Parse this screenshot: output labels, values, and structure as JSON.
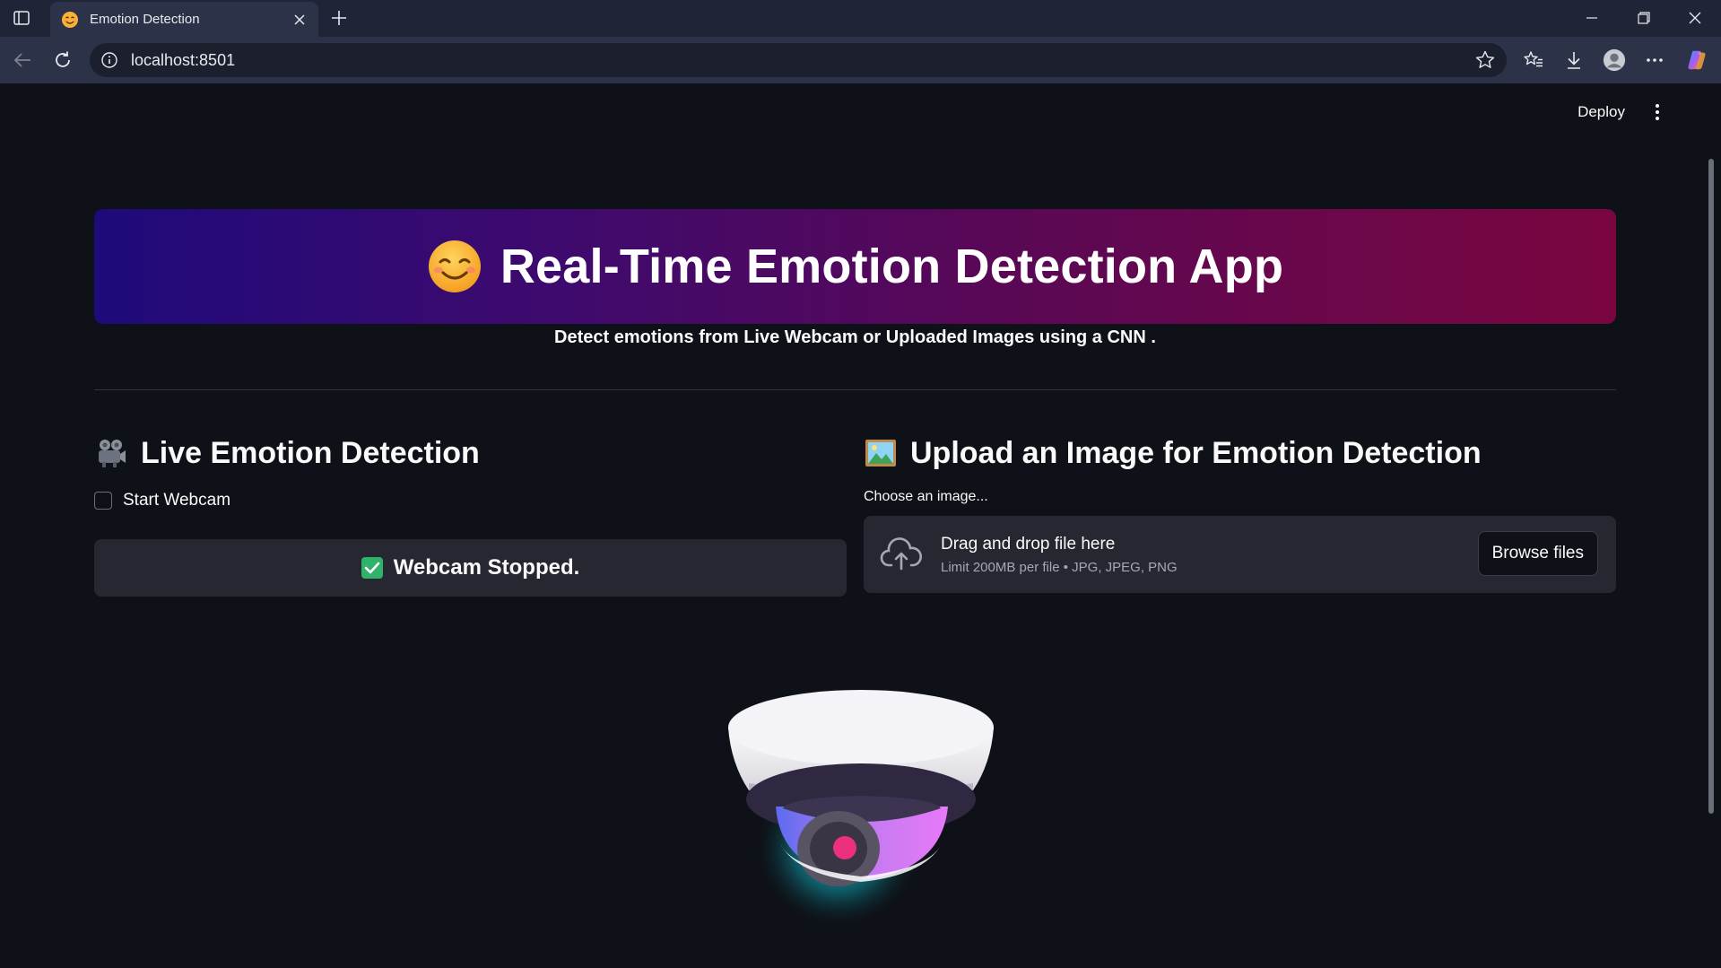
{
  "browser": {
    "tab_title": "Emotion Detection",
    "url": "localhost:8501"
  },
  "app_header": {
    "deploy_label": "Deploy"
  },
  "hero": {
    "emoji": "😊",
    "title": "Real-Time Emotion Detection App"
  },
  "subtitle": "Detect emotions from Live Webcam or Uploaded Images using a CNN .",
  "live_section": {
    "icon": "movie-camera-icon",
    "title": "Live Emotion Detection",
    "checkbox_label": "Start Webcam",
    "checkbox_checked": false,
    "status_text": "Webcam Stopped."
  },
  "upload_section": {
    "icon": "framed-picture-icon",
    "title": "Upload an Image for Emotion Detection",
    "label": "Choose an image...",
    "drop_text": "Drag and drop file here",
    "limit_text": "Limit 200MB per file • JPG, JPEG, PNG",
    "browse_label": "Browse files"
  },
  "colors": {
    "background": "#0e1117",
    "hero_gradient_start": "#1e0a7a",
    "hero_gradient_end": "#7a0640",
    "status_check": "#2fb36a",
    "panel": "#262730"
  }
}
